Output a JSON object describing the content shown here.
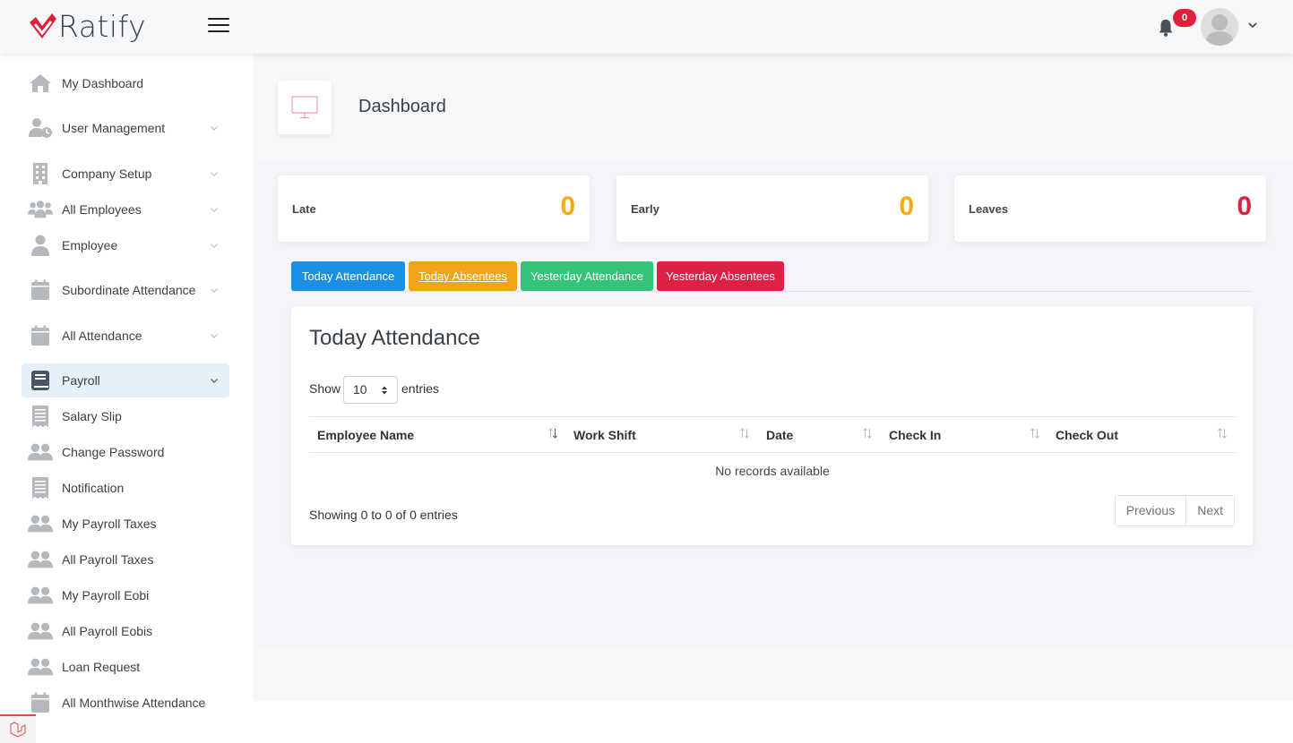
{
  "brand": {
    "name": "Ratify",
    "accent": "#e0203b"
  },
  "topbar": {
    "notification_count": "0"
  },
  "sidebar": {
    "items": [
      {
        "label": "My Dashboard",
        "icon": "home-icon",
        "has_caret": false
      },
      {
        "label": "User Management",
        "icon": "user-clock-icon",
        "has_caret": true
      },
      {
        "label": "Company Setup",
        "icon": "building-icon",
        "has_caret": true
      },
      {
        "label": "All Employees",
        "icon": "users-icon",
        "has_caret": true
      },
      {
        "label": "Employee",
        "icon": "user-icon",
        "has_caret": true
      },
      {
        "label": "Subordinate Attendance",
        "icon": "calendar-icon",
        "has_caret": true
      },
      {
        "label": "All Attendance",
        "icon": "calendar-icon",
        "has_caret": true
      },
      {
        "label": "Payroll",
        "icon": "book-icon",
        "has_caret": true,
        "active": true
      },
      {
        "label": "Salary Slip",
        "icon": "receipt-icon",
        "has_caret": false
      },
      {
        "label": "Change Password",
        "icon": "user-group-icon",
        "has_caret": false
      },
      {
        "label": "Notification",
        "icon": "receipt-icon",
        "has_caret": false
      },
      {
        "label": "My Payroll Taxes",
        "icon": "user-group-icon",
        "has_caret": false
      },
      {
        "label": "All Payroll Taxes",
        "icon": "user-group-icon",
        "has_caret": false
      },
      {
        "label": "My Payroll Eobi",
        "icon": "user-group-icon",
        "has_caret": false
      },
      {
        "label": "All Payroll Eobis",
        "icon": "user-group-icon",
        "has_caret": false
      },
      {
        "label": "Loan Request",
        "icon": "user-group-icon",
        "has_caret": false
      },
      {
        "label": "All Monthwise Attendance",
        "icon": "calendar-icon",
        "has_caret": false
      }
    ]
  },
  "page": {
    "title": "Dashboard"
  },
  "stats": [
    {
      "label": "Late",
      "value": "0",
      "color": "#f0ad16"
    },
    {
      "label": "Early",
      "value": "0",
      "color": "#f0ad16"
    },
    {
      "label": "Leaves",
      "value": "0",
      "color": "#dc2040"
    }
  ],
  "tabs": [
    {
      "label": "Today Attendance",
      "color": "#1a8fe3"
    },
    {
      "label": "Today Absentees",
      "color": "#f0a417"
    },
    {
      "label": "Yesterday Attendance",
      "color": "#34c379"
    },
    {
      "label": "Yesterday Absentees",
      "color": "#dc2046"
    }
  ],
  "table": {
    "title": "Today Attendance",
    "show_label": "Show",
    "entries_value": "10",
    "entries_label": "entries",
    "columns": [
      "Employee Name",
      "Work Shift",
      "Date",
      "Check In",
      "Check Out"
    ],
    "empty_text": "No records available",
    "info": "Showing 0 to 0 of 0 entries",
    "prev_label": "Previous",
    "next_label": "Next"
  }
}
